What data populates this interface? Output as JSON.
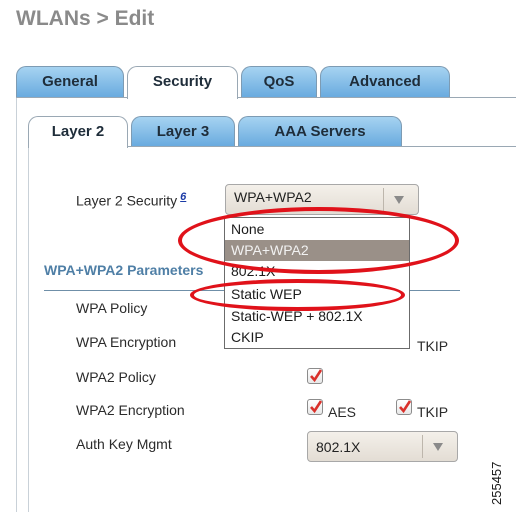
{
  "page": {
    "title": "WLANs > Edit",
    "figure_id": "255457"
  },
  "tabs": [
    {
      "label": "General",
      "active": false
    },
    {
      "label": "Security",
      "active": true
    },
    {
      "label": "QoS",
      "active": false
    },
    {
      "label": "Advanced",
      "active": false
    }
  ],
  "subtabs": [
    {
      "label": "Layer 2",
      "active": true
    },
    {
      "label": "Layer 3",
      "active": false
    },
    {
      "label": "AAA Servers",
      "active": false
    }
  ],
  "layer2_security": {
    "label": "Layer 2 Security",
    "help_link": "6",
    "selected": "WPA+WPA2",
    "options": [
      "None",
      "WPA+WPA2",
      "802.1X",
      "Static WEP",
      "Static-WEP + 802.1X",
      "CKIP"
    ],
    "highlighted_option": "WPA+WPA2"
  },
  "section": {
    "header": "WPA+WPA2 Parameters"
  },
  "fields": {
    "wpa_policy": {
      "label": "WPA Policy"
    },
    "wpa_encryption": {
      "label": "WPA Encryption",
      "tkip_label": "TKIP"
    },
    "wpa2_policy": {
      "label": "WPA2 Policy",
      "checked": true
    },
    "wpa2_encryption": {
      "label": "WPA2 Encryption",
      "aes_label": "AES",
      "aes_checked": true,
      "tkip_label": "TKIP",
      "tkip_checked": true
    },
    "auth_key_mgmt": {
      "label": "Auth Key Mgmt",
      "selected": "802.1X"
    }
  },
  "colors": {
    "tab_inactive": "#67a9de",
    "section_header": "#4f7fa6",
    "checkmark": "#d9302a",
    "highlight_ellipse": "#e0121a",
    "dropdown_selected": "#9a9088"
  }
}
